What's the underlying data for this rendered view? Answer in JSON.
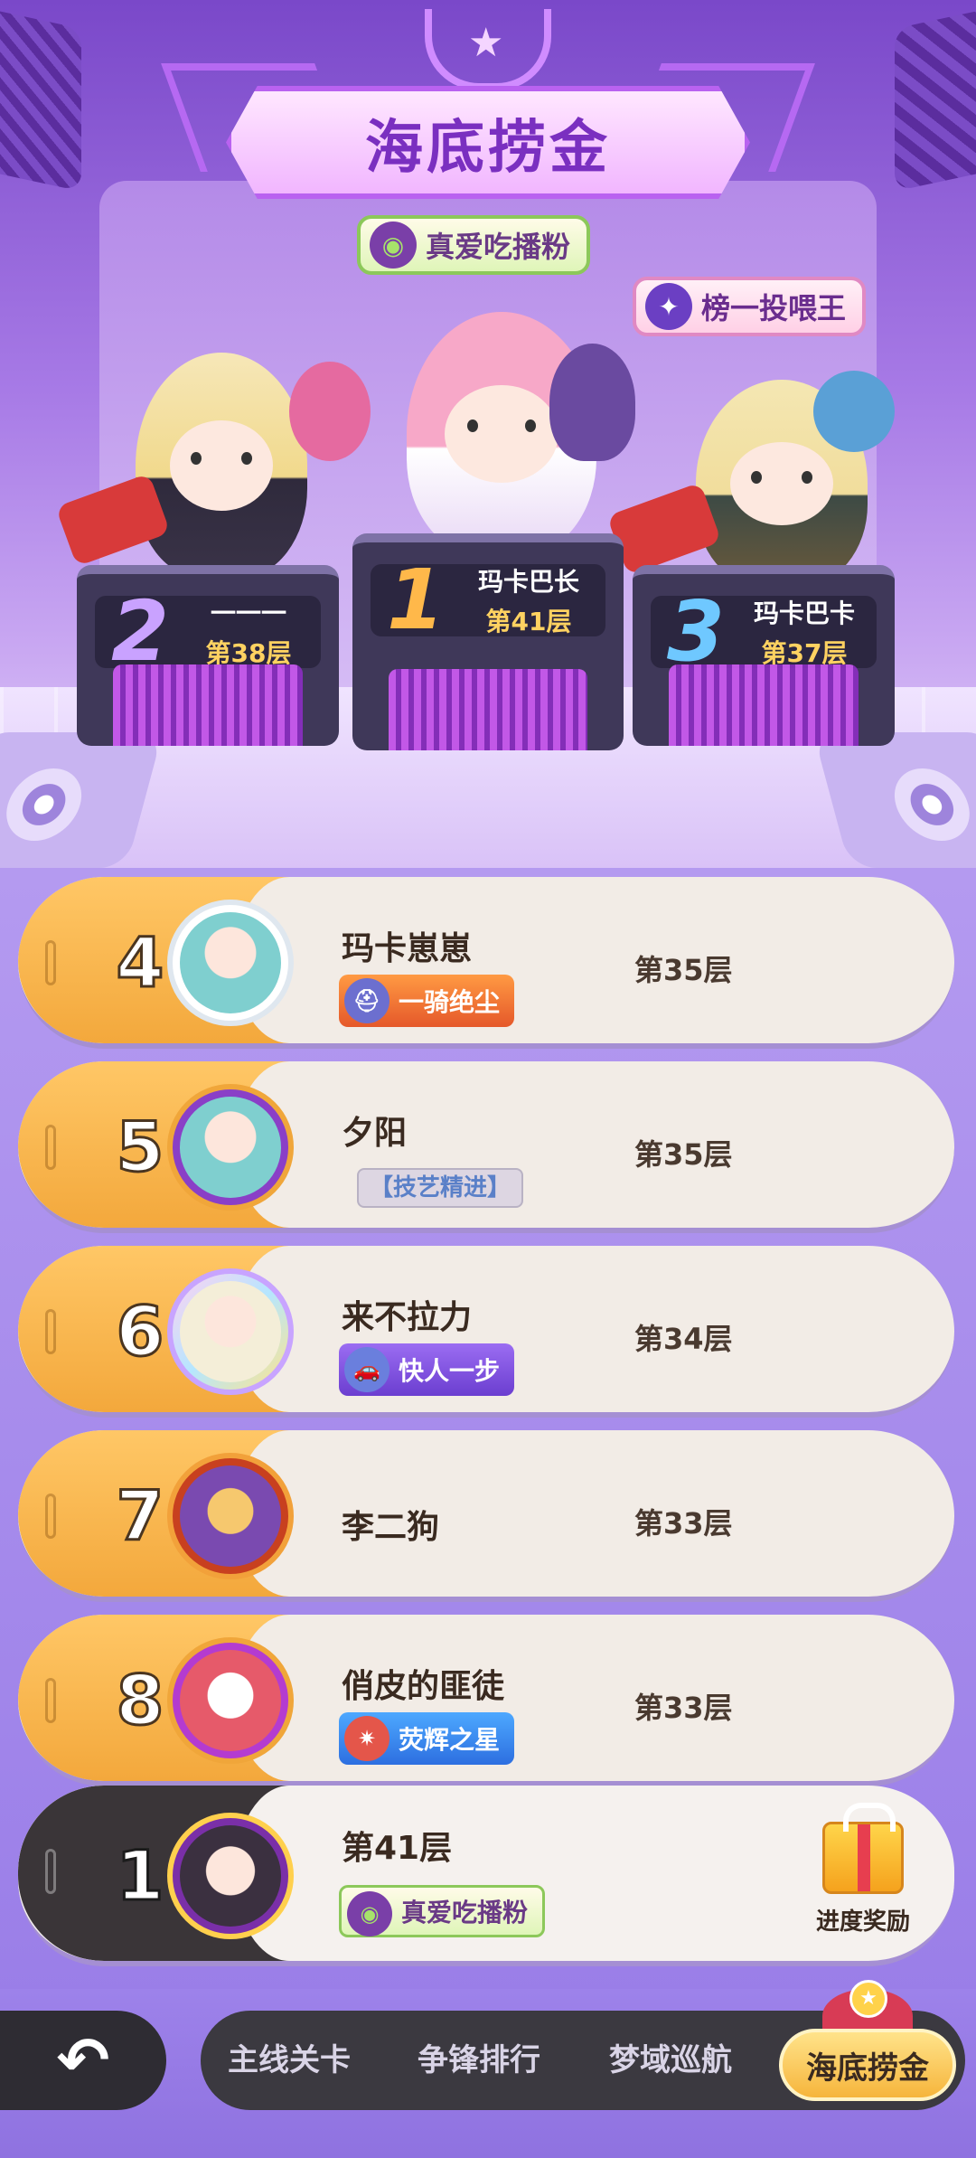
{
  "header": {
    "title": "海底捞金",
    "badge_top": "真爱吃播粉",
    "badge_right": "榜一投喂王"
  },
  "podium": [
    {
      "rank": "2",
      "name": "一一一",
      "floor": "第38层",
      "rank_color": "#c9a2ff"
    },
    {
      "rank": "1",
      "name": "玛卡巴长",
      "floor": "第41层",
      "rank_color": "#ffb84a"
    },
    {
      "rank": "3",
      "name": "玛卡巴卡",
      "floor": "第37层",
      "rank_color": "#6fc8ff"
    }
  ],
  "list": [
    {
      "rank": "4",
      "name": "玛卡崽崽",
      "floor": "第35层",
      "tag": "一骑绝尘",
      "tag_icon": "helmet-icon"
    },
    {
      "rank": "5",
      "name": "夕阳",
      "floor": "第35层",
      "tag": "【技艺精进】",
      "tag_icon": ""
    },
    {
      "rank": "6",
      "name": "来不拉力",
      "floor": "第34层",
      "tag": "快人一步",
      "tag_icon": "car-icon"
    },
    {
      "rank": "7",
      "name": "李二狗",
      "floor": "第33层",
      "tag": "",
      "tag_icon": ""
    },
    {
      "rank": "8",
      "name": "俏皮的匪徒",
      "floor": "第33层",
      "tag": "荧辉之星",
      "tag_icon": "star-emblem-icon"
    }
  ],
  "self": {
    "rank": "1",
    "floor": "第41层",
    "tag": "真爱吃播粉",
    "reward_label": "进度奖励"
  },
  "nav": {
    "back": "↶",
    "items": [
      "主线关卡",
      "争锋排行",
      "梦域巡航"
    ],
    "active": "海底捞金"
  }
}
